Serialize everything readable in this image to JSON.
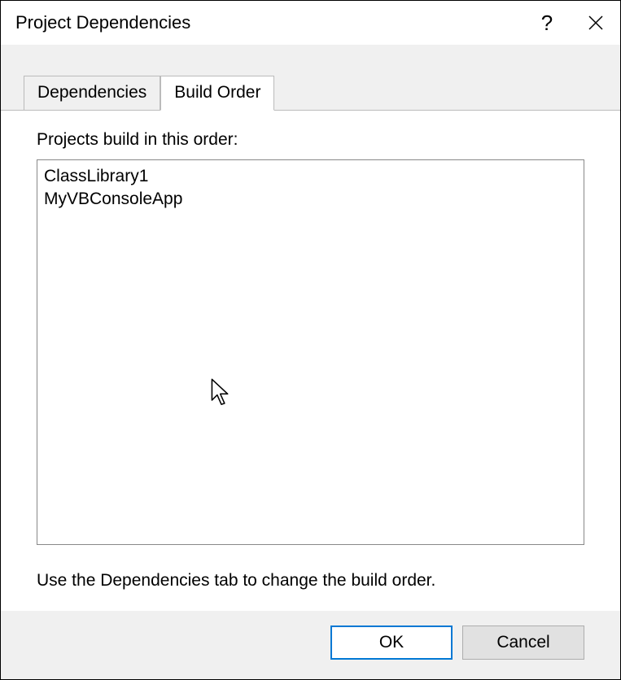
{
  "titlebar": {
    "title": "Project Dependencies"
  },
  "tabs": {
    "dependencies": "Dependencies",
    "buildOrder": "Build Order"
  },
  "content": {
    "label": "Projects build in this order:",
    "items": [
      "ClassLibrary1",
      "MyVBConsoleApp"
    ],
    "hint": "Use the Dependencies tab to change the build order."
  },
  "buttons": {
    "ok": "OK",
    "cancel": "Cancel"
  }
}
